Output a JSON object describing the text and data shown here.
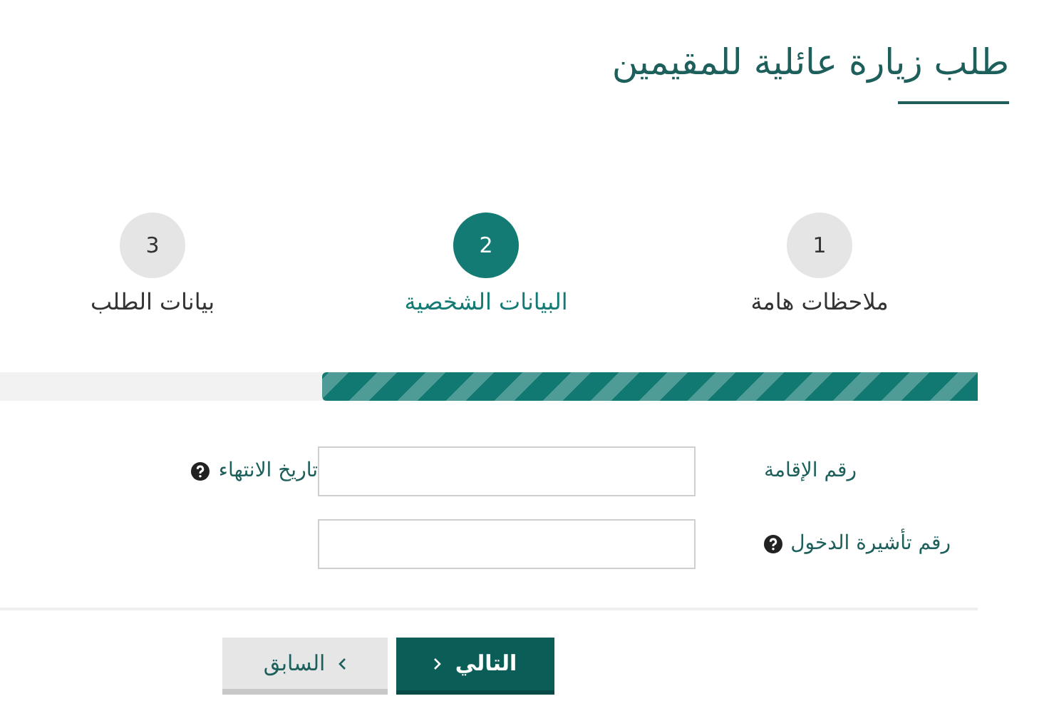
{
  "title": "طلب زيارة عائلية للمقيمين",
  "steps": [
    {
      "number": "1",
      "label": "ملاحظات هامة",
      "selected": false
    },
    {
      "number": "2",
      "label": "البيانات الشخصية",
      "selected": true
    },
    {
      "number": "3",
      "label": "بيانات الطلب",
      "selected": false
    }
  ],
  "progress": {
    "level": 0.67
  },
  "form_rows": [
    {
      "fields": [
        {
          "kind": "text_input",
          "label": "رقم الإقامة",
          "help": false
        },
        {
          "kind": "label_only",
          "label": "تاريخ الانتهاء",
          "help": true
        }
      ]
    },
    {
      "fields": [
        {
          "kind": "text_input",
          "label": "رقم تأشيرة الدخول",
          "help": true
        }
      ]
    }
  ],
  "buttons": [
    {
      "label": "التالي",
      "kind": "primary"
    },
    {
      "label": "السابق",
      "kind": "secondary"
    }
  ]
}
